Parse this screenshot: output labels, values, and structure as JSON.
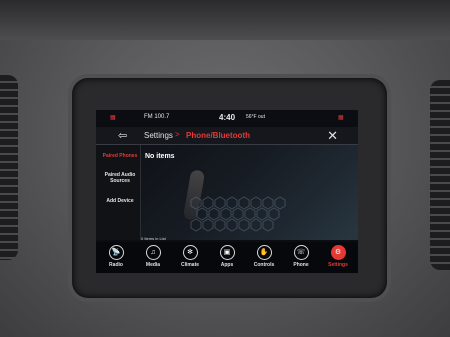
{
  "status_bar": {
    "radio": "FM 100.7",
    "time": "4:40",
    "temperature": "56°F out",
    "icons": [
      "uconnect-apps-icon",
      "phone-signal-icon",
      "apps-corner-icon"
    ]
  },
  "header": {
    "crumb_parent": "Settings",
    "crumb_separator": ">",
    "crumb_current": "Phone/Bluetooth",
    "back_icon": "back-arrow-icon",
    "close_icon": "close-icon"
  },
  "sidebar": {
    "items": [
      {
        "label": "Paired Phones",
        "active": true
      },
      {
        "label": "Paired Audio Sources",
        "active": false
      },
      {
        "label": "Add Device",
        "active": false
      }
    ]
  },
  "content": {
    "empty_text": "No items",
    "count_text": "0 Items in List"
  },
  "navbar": {
    "items": [
      {
        "label": "Radio",
        "icon": "radio-tower-icon",
        "glyph": "📡",
        "active": false
      },
      {
        "label": "Media",
        "icon": "media-note-icon",
        "glyph": "♫",
        "active": false
      },
      {
        "label": "Climate",
        "icon": "climate-fan-icon",
        "glyph": "✻",
        "active": false
      },
      {
        "label": "Apps",
        "icon": "apps-icon",
        "glyph": "▣",
        "active": false
      },
      {
        "label": "Controls",
        "icon": "controls-hand-icon",
        "glyph": "✋",
        "active": false
      },
      {
        "label": "Phone",
        "icon": "phone-icon",
        "glyph": "☏",
        "active": false
      },
      {
        "label": "Settings",
        "icon": "settings-gear-icon",
        "glyph": "⚙",
        "active": true
      }
    ]
  },
  "colors": {
    "accent": "#e53935",
    "screen_bg": "#0b0d12"
  }
}
